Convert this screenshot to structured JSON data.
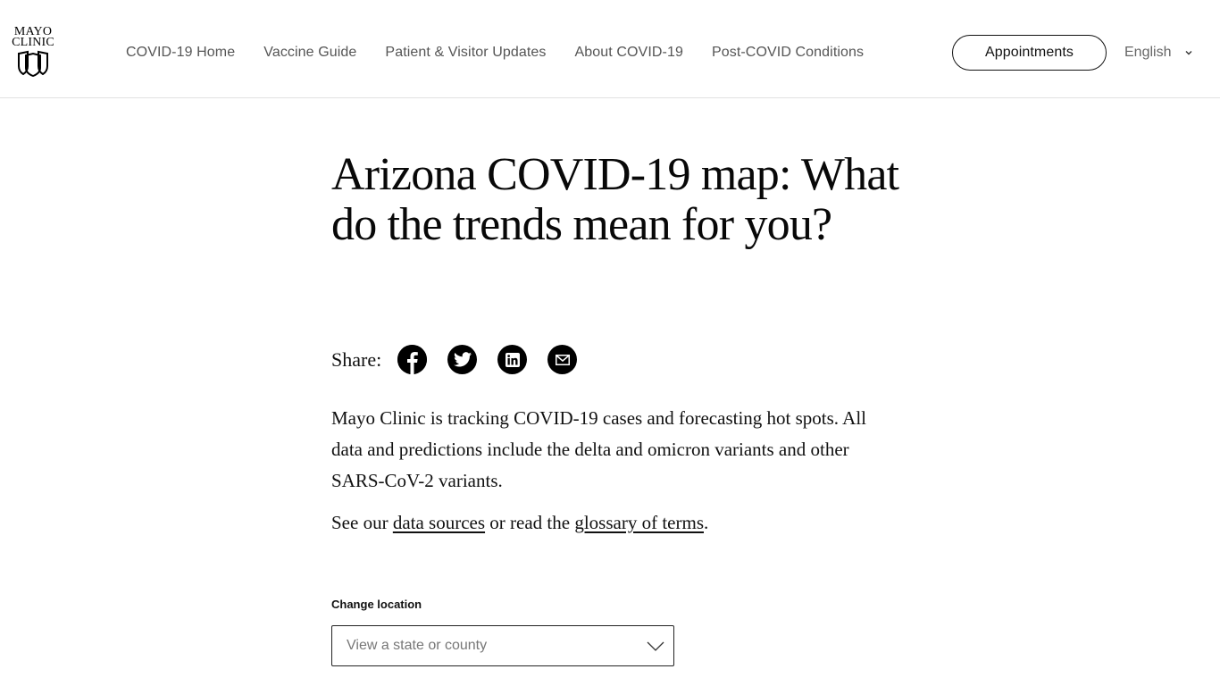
{
  "header": {
    "logo": {
      "line1": "MAYO",
      "line2": "CLINIC"
    },
    "nav": [
      {
        "label": "COVID-19 Home"
      },
      {
        "label": "Vaccine Guide"
      },
      {
        "label": "Patient & Visitor Updates"
      },
      {
        "label": "About COVID-19"
      },
      {
        "label": "Post-COVID Conditions"
      }
    ],
    "appointments_label": "Appointments",
    "language": {
      "selected": "English",
      "icon": "chevron-down-icon"
    }
  },
  "article": {
    "title": "Arizona COVID-19 map: What do the trends mean for you?",
    "share": {
      "label": "Share:",
      "icons": [
        "facebook-icon",
        "twitter-icon",
        "linkedin-icon",
        "email-icon"
      ]
    },
    "intro": "Mayo Clinic is tracking COVID-19 cases and forecasting hot spots. All data and predictions include the delta and omicron variants and other SARS-CoV-2 variants.",
    "sources": {
      "prefix": "See our ",
      "link1": "data sources",
      "middle": " or read the ",
      "link2": "glossary of terms",
      "suffix": "."
    }
  },
  "location": {
    "label": "Change location",
    "placeholder": "View a state or county",
    "icon": "chevron-down-icon"
  }
}
